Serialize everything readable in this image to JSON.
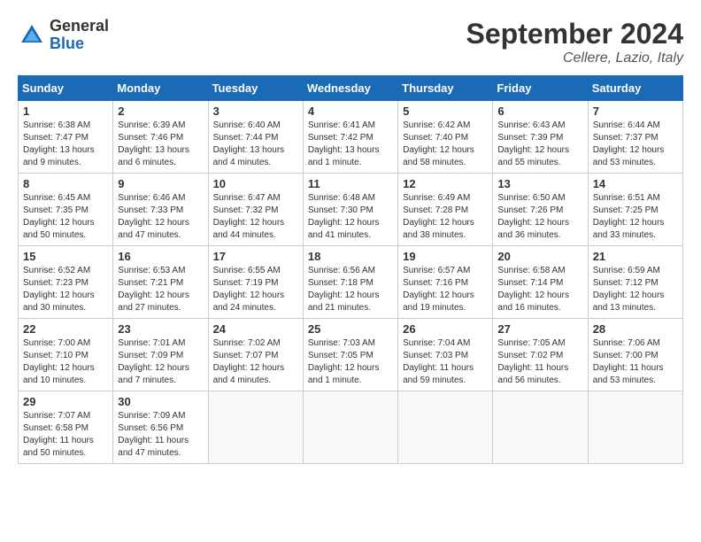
{
  "logo": {
    "general": "General",
    "blue": "Blue"
  },
  "title": "September 2024",
  "location": "Cellere, Lazio, Italy",
  "weekdays": [
    "Sunday",
    "Monday",
    "Tuesday",
    "Wednesday",
    "Thursday",
    "Friday",
    "Saturday"
  ],
  "weeks": [
    [
      {
        "day": "1",
        "info": "Sunrise: 6:38 AM\nSunset: 7:47 PM\nDaylight: 13 hours\nand 9 minutes."
      },
      {
        "day": "2",
        "info": "Sunrise: 6:39 AM\nSunset: 7:46 PM\nDaylight: 13 hours\nand 6 minutes."
      },
      {
        "day": "3",
        "info": "Sunrise: 6:40 AM\nSunset: 7:44 PM\nDaylight: 13 hours\nand 4 minutes."
      },
      {
        "day": "4",
        "info": "Sunrise: 6:41 AM\nSunset: 7:42 PM\nDaylight: 13 hours\nand 1 minute."
      },
      {
        "day": "5",
        "info": "Sunrise: 6:42 AM\nSunset: 7:40 PM\nDaylight: 12 hours\nand 58 minutes."
      },
      {
        "day": "6",
        "info": "Sunrise: 6:43 AM\nSunset: 7:39 PM\nDaylight: 12 hours\nand 55 minutes."
      },
      {
        "day": "7",
        "info": "Sunrise: 6:44 AM\nSunset: 7:37 PM\nDaylight: 12 hours\nand 53 minutes."
      }
    ],
    [
      {
        "day": "8",
        "info": "Sunrise: 6:45 AM\nSunset: 7:35 PM\nDaylight: 12 hours\nand 50 minutes."
      },
      {
        "day": "9",
        "info": "Sunrise: 6:46 AM\nSunset: 7:33 PM\nDaylight: 12 hours\nand 47 minutes."
      },
      {
        "day": "10",
        "info": "Sunrise: 6:47 AM\nSunset: 7:32 PM\nDaylight: 12 hours\nand 44 minutes."
      },
      {
        "day": "11",
        "info": "Sunrise: 6:48 AM\nSunset: 7:30 PM\nDaylight: 12 hours\nand 41 minutes."
      },
      {
        "day": "12",
        "info": "Sunrise: 6:49 AM\nSunset: 7:28 PM\nDaylight: 12 hours\nand 38 minutes."
      },
      {
        "day": "13",
        "info": "Sunrise: 6:50 AM\nSunset: 7:26 PM\nDaylight: 12 hours\nand 36 minutes."
      },
      {
        "day": "14",
        "info": "Sunrise: 6:51 AM\nSunset: 7:25 PM\nDaylight: 12 hours\nand 33 minutes."
      }
    ],
    [
      {
        "day": "15",
        "info": "Sunrise: 6:52 AM\nSunset: 7:23 PM\nDaylight: 12 hours\nand 30 minutes."
      },
      {
        "day": "16",
        "info": "Sunrise: 6:53 AM\nSunset: 7:21 PM\nDaylight: 12 hours\nand 27 minutes."
      },
      {
        "day": "17",
        "info": "Sunrise: 6:55 AM\nSunset: 7:19 PM\nDaylight: 12 hours\nand 24 minutes."
      },
      {
        "day": "18",
        "info": "Sunrise: 6:56 AM\nSunset: 7:18 PM\nDaylight: 12 hours\nand 21 minutes."
      },
      {
        "day": "19",
        "info": "Sunrise: 6:57 AM\nSunset: 7:16 PM\nDaylight: 12 hours\nand 19 minutes."
      },
      {
        "day": "20",
        "info": "Sunrise: 6:58 AM\nSunset: 7:14 PM\nDaylight: 12 hours\nand 16 minutes."
      },
      {
        "day": "21",
        "info": "Sunrise: 6:59 AM\nSunset: 7:12 PM\nDaylight: 12 hours\nand 13 minutes."
      }
    ],
    [
      {
        "day": "22",
        "info": "Sunrise: 7:00 AM\nSunset: 7:10 PM\nDaylight: 12 hours\nand 10 minutes."
      },
      {
        "day": "23",
        "info": "Sunrise: 7:01 AM\nSunset: 7:09 PM\nDaylight: 12 hours\nand 7 minutes."
      },
      {
        "day": "24",
        "info": "Sunrise: 7:02 AM\nSunset: 7:07 PM\nDaylight: 12 hours\nand 4 minutes."
      },
      {
        "day": "25",
        "info": "Sunrise: 7:03 AM\nSunset: 7:05 PM\nDaylight: 12 hours\nand 1 minute."
      },
      {
        "day": "26",
        "info": "Sunrise: 7:04 AM\nSunset: 7:03 PM\nDaylight: 11 hours\nand 59 minutes."
      },
      {
        "day": "27",
        "info": "Sunrise: 7:05 AM\nSunset: 7:02 PM\nDaylight: 11 hours\nand 56 minutes."
      },
      {
        "day": "28",
        "info": "Sunrise: 7:06 AM\nSunset: 7:00 PM\nDaylight: 11 hours\nand 53 minutes."
      }
    ],
    [
      {
        "day": "29",
        "info": "Sunrise: 7:07 AM\nSunset: 6:58 PM\nDaylight: 11 hours\nand 50 minutes."
      },
      {
        "day": "30",
        "info": "Sunrise: 7:09 AM\nSunset: 6:56 PM\nDaylight: 11 hours\nand 47 minutes."
      },
      {
        "day": "",
        "info": ""
      },
      {
        "day": "",
        "info": ""
      },
      {
        "day": "",
        "info": ""
      },
      {
        "day": "",
        "info": ""
      },
      {
        "day": "",
        "info": ""
      }
    ]
  ]
}
